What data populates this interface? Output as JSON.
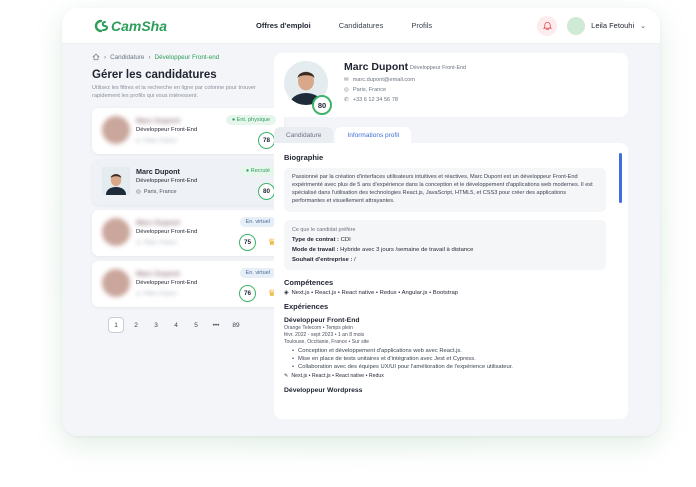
{
  "brand": {
    "name": "CamSha",
    "color": "#2e9d5a"
  },
  "nav": [
    {
      "label": "Offres d'emploi",
      "active": true
    },
    {
      "label": "Candidatures",
      "active": false
    },
    {
      "label": "Profils",
      "active": false
    }
  ],
  "user": {
    "name": "Leila Fetouhi"
  },
  "breadcrumb": {
    "parent": "Candidature",
    "current": "Développeur Front-end"
  },
  "left": {
    "title": "Gérer les candidatures",
    "subtitle": "Utilisez les filtres et la recherche en ligne par colonne pour trouver rapidement les profils qui vous intéressent.",
    "cards": [
      {
        "name": "Marc Dupont",
        "role": "Développeur Front-End",
        "location": "Paris, France",
        "badge": "Ent. physique",
        "badge_color": "green",
        "score": "78",
        "blurred": true,
        "crown": false
      },
      {
        "name": "Marc Dupont",
        "role": "Développeur Front-End",
        "location": "Paris, France",
        "badge": "Recruté",
        "badge_color": "green",
        "score": "80",
        "blurred": false,
        "crown": false
      },
      {
        "name": "Marc Dupont",
        "role": "Développeur Front-End",
        "location": "Paris, France",
        "badge": "En. virtuel",
        "badge_color": "blue",
        "score": "75",
        "blurred": true,
        "crown": true
      },
      {
        "name": "Marc Dupont",
        "role": "Développeur Front-End",
        "location": "Paris, France",
        "badge": "En. virtuel",
        "badge_color": "blue",
        "score": "76",
        "blurred": true,
        "crown": true
      }
    ],
    "pagination": [
      "1",
      "2",
      "3",
      "4",
      "5",
      "•••",
      "89"
    ]
  },
  "profile": {
    "name": "Marc Dupont",
    "role": "Développeur Front-End",
    "email": "marc.dupont@email.com",
    "location": "Paris, France",
    "phone": "+33 6 12 34 56 78",
    "score": "80"
  },
  "tabs": [
    {
      "label": "Candidature",
      "active": false
    },
    {
      "label": "Informations profil",
      "active": true
    }
  ],
  "bio": {
    "heading": "Biographie",
    "text": "Passionné par la création d'interfaces utilisateurs intuitives et réactives, Marc Dupont est un développeur Front-End expérimenté avec plus de 5 ans d'expérience dans la conception et le développement d'applications web modernes. Il est spécialisé dans l'utilisation des technologies React.js, JavaScript, HTML5, et CSS3 pour créer des applications performantes et visuellement attrayantes."
  },
  "preferences": {
    "heading": "Ce que le candidat préfère",
    "contract_label": "Type de contrat :",
    "contract_value": "CDI",
    "mode_label": "Mode de travail :",
    "mode_value": "Hybride avec 3 jours /semaine de travail à distance",
    "company_label": "Souhait d'entreprise :",
    "company_value": "/"
  },
  "skills": {
    "heading": "Compétences",
    "list": "Next.js • React.js • React native • Redux • Angular.js • Bootstrap"
  },
  "experiences": {
    "heading": "Expériences",
    "items": [
      {
        "title": "Développeur Front-End",
        "company": "Orange Telecom  •  Temps plein",
        "dates": "févr. 2022 - sept 2023  •  1 an 8 mois",
        "place": "Toulouse, Occitanie, France  •  Sur site",
        "bullets": [
          "Conception et développement d'applications web avec React.js.",
          "Mise en place de tests unitaires et d'intégration avec Jest et Cypress.",
          "Collaboration avec des équipes UX/UI pour l'amélioration de l'expérience utilisateur."
        ],
        "tags": "Next.js • React.js • React native • Redux"
      },
      {
        "title": "Développeur Wordpress"
      }
    ]
  },
  "colors": {
    "accent": "#3f6fd8",
    "score_ring": "#3fb36b",
    "crown": "#f0a81c"
  }
}
